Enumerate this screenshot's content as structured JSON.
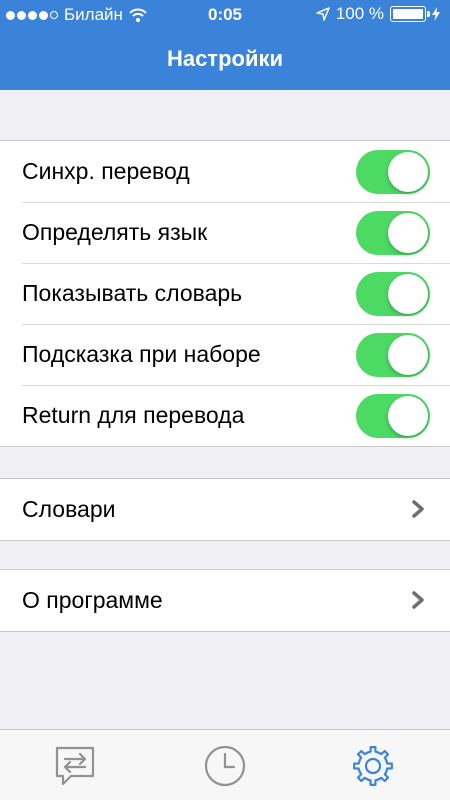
{
  "status_bar": {
    "signal_dots": 5,
    "signal_filled": 4,
    "carrier": "Билайн",
    "time": "0:05",
    "battery_percent": "100 %"
  },
  "header": {
    "title": "Настройки"
  },
  "settings": {
    "toggles": [
      {
        "label": "Синхр. перевод",
        "on": true
      },
      {
        "label": "Определять язык",
        "on": true
      },
      {
        "label": "Показывать словарь",
        "on": true
      },
      {
        "label": "Подсказка при наборе",
        "on": true
      },
      {
        "label": "Return для перевода",
        "on": true
      }
    ],
    "dictionaries": {
      "label": "Словари"
    },
    "about": {
      "label": "О программе"
    }
  },
  "tabbar": {
    "tabs": [
      {
        "icon": "translate-icon",
        "active": false
      },
      {
        "icon": "history-icon",
        "active": false
      },
      {
        "icon": "settings-gear-icon",
        "active": true
      }
    ]
  },
  "colors": {
    "header": "#3b83d9",
    "toggle_on": "#4cd964",
    "active_tab": "#3b83d9",
    "inactive_tab": "#929292"
  }
}
